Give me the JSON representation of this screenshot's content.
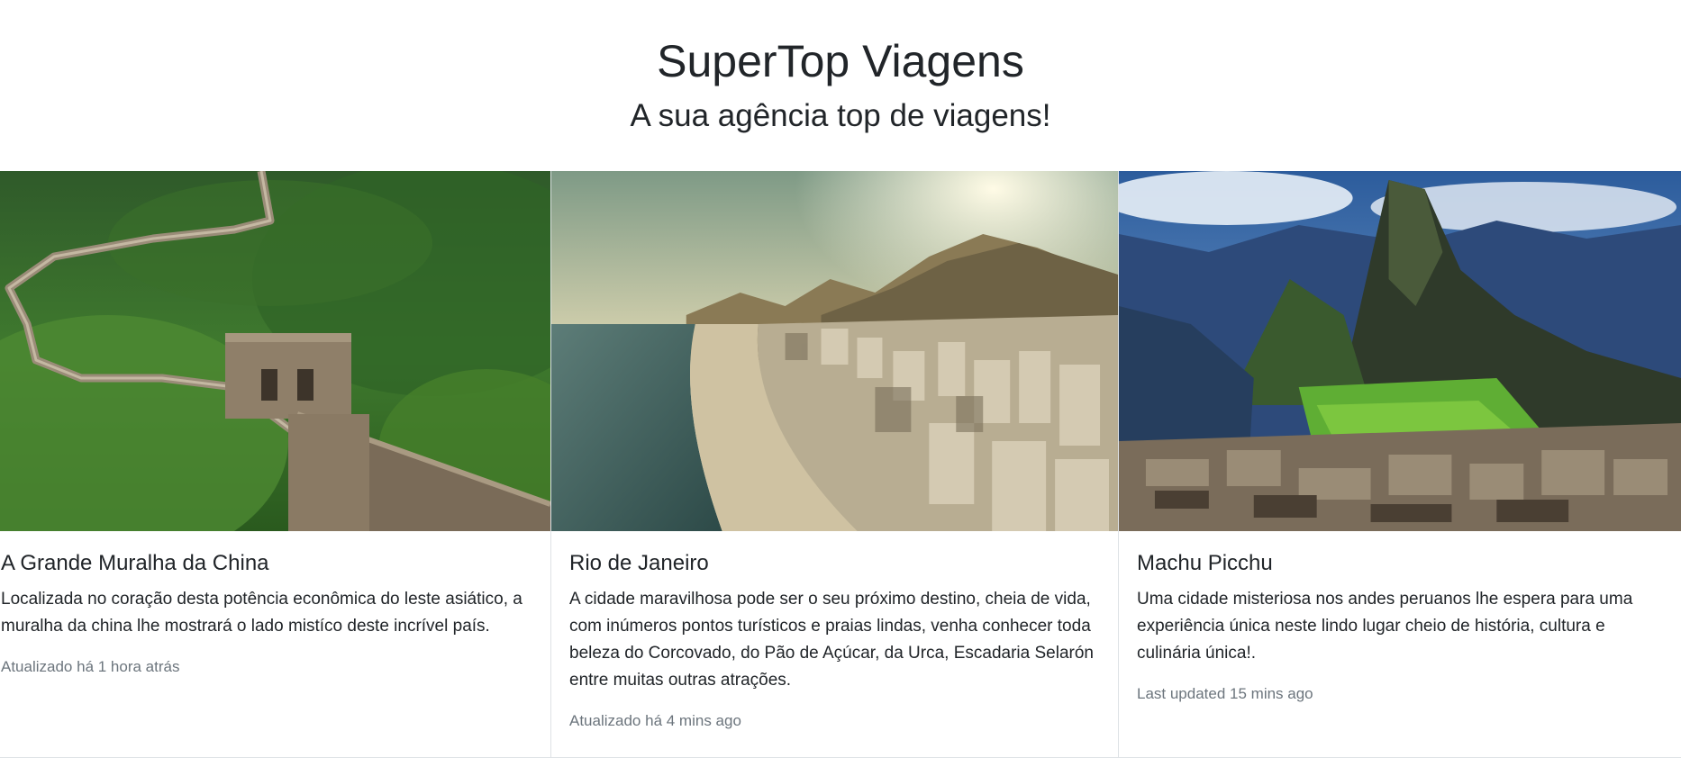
{
  "header": {
    "title": "SuperTop Viagens",
    "subtitle": "A sua agência top de viagens!"
  },
  "cards": [
    {
      "image_alt": "Great Wall of China photo",
      "title": "A Grande Muralha da China",
      "text": "Localizada no coração desta potência econômica do leste asiático, a muralha da china lhe mostrará o lado mistíco deste incrível país.",
      "updated": "Atualizado há 1 hora atrás"
    },
    {
      "image_alt": "Rio de Janeiro beach photo",
      "title": "Rio de Janeiro",
      "text": "A cidade maravilhosa pode ser o seu próximo destino, cheia de vida, com inúmeros pontos turísticos e praias lindas, venha conhecer toda beleza do Corcovado, do Pão de Açúcar, da Urca, Escadaria Selarón entre muitas outras atrações.",
      "updated": "Atualizado há 4 mins ago"
    },
    {
      "image_alt": "Machu Picchu photo",
      "title": "Machu Picchu",
      "text": "Uma cidade misteriosa nos andes peruanos lhe espera para uma experiência única neste lindo lugar cheio de história, cultura e culinária única!.",
      "updated": "Last updated 15 mins ago"
    }
  ]
}
